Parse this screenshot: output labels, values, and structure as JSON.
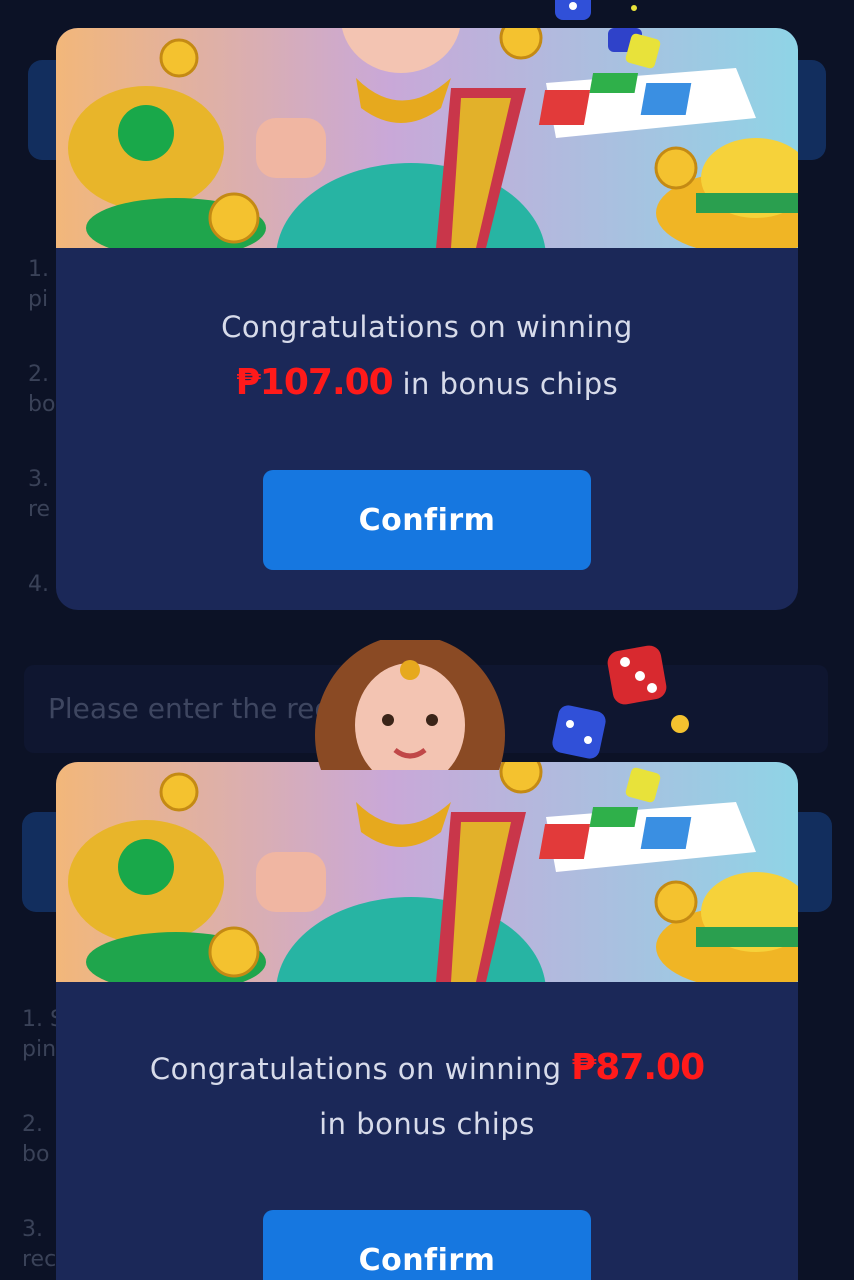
{
  "background": {
    "input_placeholder": "Please enter the redeem code",
    "list_markers_top": [
      "1.",
      "2.",
      "3.",
      "4."
    ],
    "list_fragments_top": [
      "pi",
      "bo",
      "re"
    ],
    "list_markers_bottom": [
      "1. S",
      "2.",
      "3."
    ],
    "list_fragments_bottom": [
      "pin",
      "bo",
      "rec"
    ]
  },
  "dialogs": [
    {
      "message_line1": "Congratulations on winning",
      "amount": "₱107.00",
      "message_suffix": "in bonus chips",
      "confirm_label": "Confirm"
    },
    {
      "message_prefix": "Congratulations on winning",
      "amount": "₱87.00",
      "message_line2": "in bonus chips",
      "confirm_label": "Confirm"
    }
  ],
  "colors": {
    "modal_bg": "#1b2858",
    "confirm_bg": "#1677e0",
    "amount": "#ff1a1a",
    "page_bg": "#0c1226"
  },
  "icons": [
    "dice-icon",
    "gold-coin-icon",
    "ludo-board-icon",
    "gold-ingot-icon"
  ]
}
